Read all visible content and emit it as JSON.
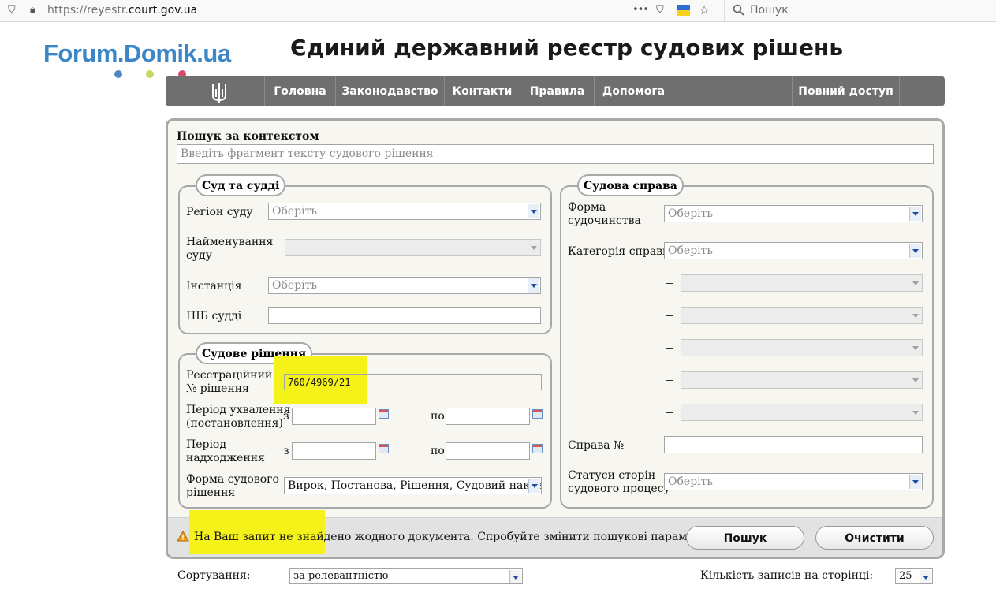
{
  "browser": {
    "url_prefix": "https://reyestr.",
    "url_domain": "court.gov.ua",
    "search_placeholder": "Пошук",
    "menu_dots": "•••"
  },
  "site": {
    "logo_text": "Forum.Domik.ua",
    "title": "Єдиний державний реєстр судових рішень"
  },
  "nav": {
    "items": [
      "Головна",
      "Законодавство",
      "Контакти",
      "Правила",
      "Допомога"
    ],
    "full_access": "Повний доступ"
  },
  "context_search": {
    "label": "Пошук за контекстом",
    "placeholder": "Введіть фрагмент тексту судового рішення"
  },
  "court_judges": {
    "legend": "Суд та судді",
    "region_label": "Регіон суду",
    "region_value": "Оберіть",
    "court_name_label_1": "Найменування",
    "court_name_label_2": "суду",
    "instance_label": "Інстанція",
    "instance_value": "Оберіть",
    "judge_label": "ПІБ судді",
    "judge_value": ""
  },
  "decision": {
    "legend": "Судове рішення",
    "reg_label_1": "Реєстраційний",
    "reg_label_2": "№ рішення",
    "reg_value": "760/4969/21",
    "adopt_label_1": "Період ухвалення",
    "adopt_label_2": "(постановлення)",
    "receive_label_1": "Період",
    "receive_label_2": "надходження",
    "from": "з",
    "to": "по",
    "form_label_1": "Форма судового",
    "form_label_2": "рішення",
    "form_value": "Вирок, Постанова, Рішення, Судовий наказ, Ухвала"
  },
  "case": {
    "legend": "Судова справа",
    "proc_label_1": "Форма",
    "proc_label_2": "судочинства",
    "proc_value": "Оберіть",
    "category_label": "Категорія справи",
    "category_value": "Оберіть",
    "case_no_label": "Справа №",
    "case_no_value": "",
    "status_label_1": "Статуси сторін",
    "status_label_2": "судового процесу",
    "status_value": "Оберіть"
  },
  "footer": {
    "message": "На Ваш запит не знайдено жодного документа. Спробуйте змінити пошукові параметри.",
    "search_button": "Пошук",
    "clear_button": "Очистити"
  },
  "sorting": {
    "label": "Сортування:",
    "value": "за релевантністю",
    "per_page_label": "Кількість записів на сторінці:",
    "per_page_value": "25"
  },
  "colors": {
    "highlight": "#f5f21a",
    "logo": "#3b86c7",
    "nav": "#6f6f6f"
  }
}
